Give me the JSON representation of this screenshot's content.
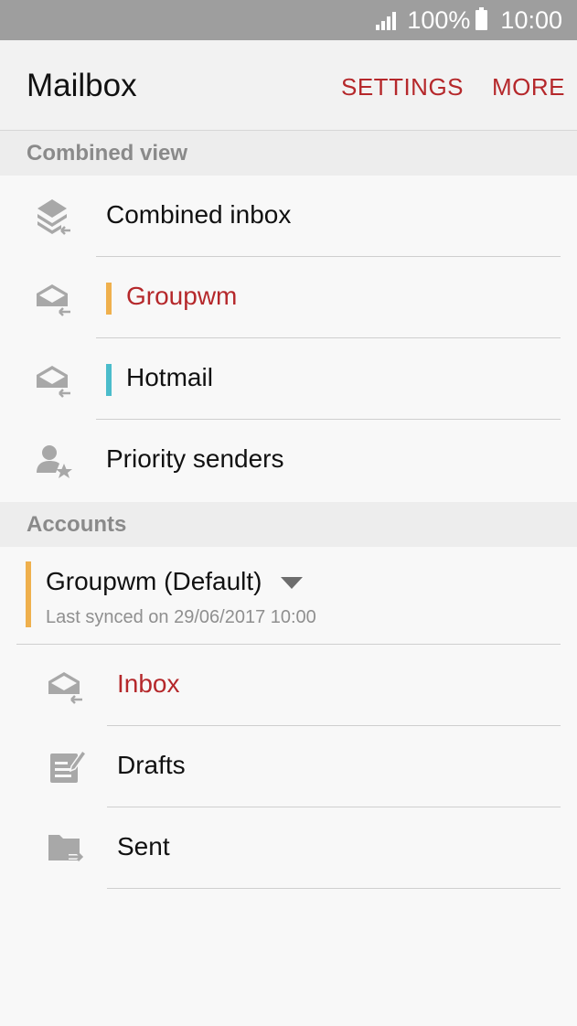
{
  "status_bar": {
    "battery_text": "100%",
    "time": "10:00"
  },
  "app_bar": {
    "title": "Mailbox",
    "settings_label": "SETTINGS",
    "more_label": "MORE"
  },
  "combined": {
    "header": "Combined view",
    "items": [
      {
        "label": "Combined inbox",
        "icon": "inbox-stack-icon"
      },
      {
        "label": "Groupwm",
        "icon": "inbox-icon",
        "color": "#efb04d"
      },
      {
        "label": "Hotmail",
        "icon": "inbox-icon",
        "color": "#4bbccb"
      },
      {
        "label": "Priority senders",
        "icon": "priority-sender-icon"
      }
    ]
  },
  "accounts": {
    "header": "Accounts",
    "current": {
      "name": "Groupwm (Default)",
      "last_synced": "Last synced on 29/06/2017 10:00",
      "color": "#efb04d"
    },
    "folders": [
      {
        "label": "Inbox",
        "icon": "inbox-icon",
        "selected": true
      },
      {
        "label": "Drafts",
        "icon": "drafts-icon"
      },
      {
        "label": "Sent",
        "icon": "sent-folder-icon"
      }
    ]
  },
  "colors": {
    "accent_red": "#b5282b",
    "icon_gray": "#a8a8a8"
  }
}
